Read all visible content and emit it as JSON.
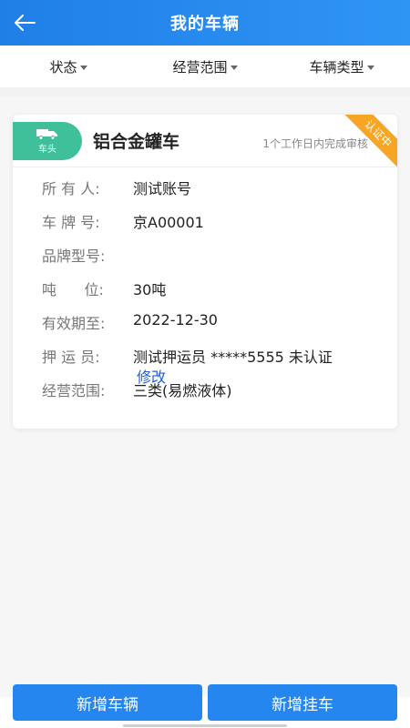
{
  "header": {
    "title": "我的车辆",
    "back_icon": "back-arrow-icon"
  },
  "filters": [
    {
      "label": "状态"
    },
    {
      "label": "经营范围"
    },
    {
      "label": "车辆类型"
    }
  ],
  "vehicle": {
    "tag_label": "车头",
    "tag_icon": "truck-icon",
    "type": "铝合金罐车",
    "review_note": "1个工作日内完成审核",
    "status_ribbon": "认证中",
    "fields": [
      {
        "label": "所 有 人:",
        "value": "测试账号"
      },
      {
        "label": "车 牌 号:",
        "value": "京A00001"
      },
      {
        "label": "品牌型号:",
        "value": ""
      },
      {
        "label": "吨      位:",
        "value": "30吨"
      },
      {
        "label": "有效期至:",
        "value": "2022-12-30"
      },
      {
        "label": "押 运 员:",
        "value": "测试押运员 *****5555 未认证"
      },
      {
        "label": "经营范围:",
        "value": "三类(易燃液体)"
      }
    ],
    "edit_label": "修改"
  },
  "actions": {
    "add_vehicle": "新增车辆",
    "add_trailer": "新增挂车"
  },
  "colors": {
    "primary": "#2486ee",
    "tag": "#3fbf9a",
    "ribbon": "#f6a623",
    "link": "#1f5fd6"
  }
}
